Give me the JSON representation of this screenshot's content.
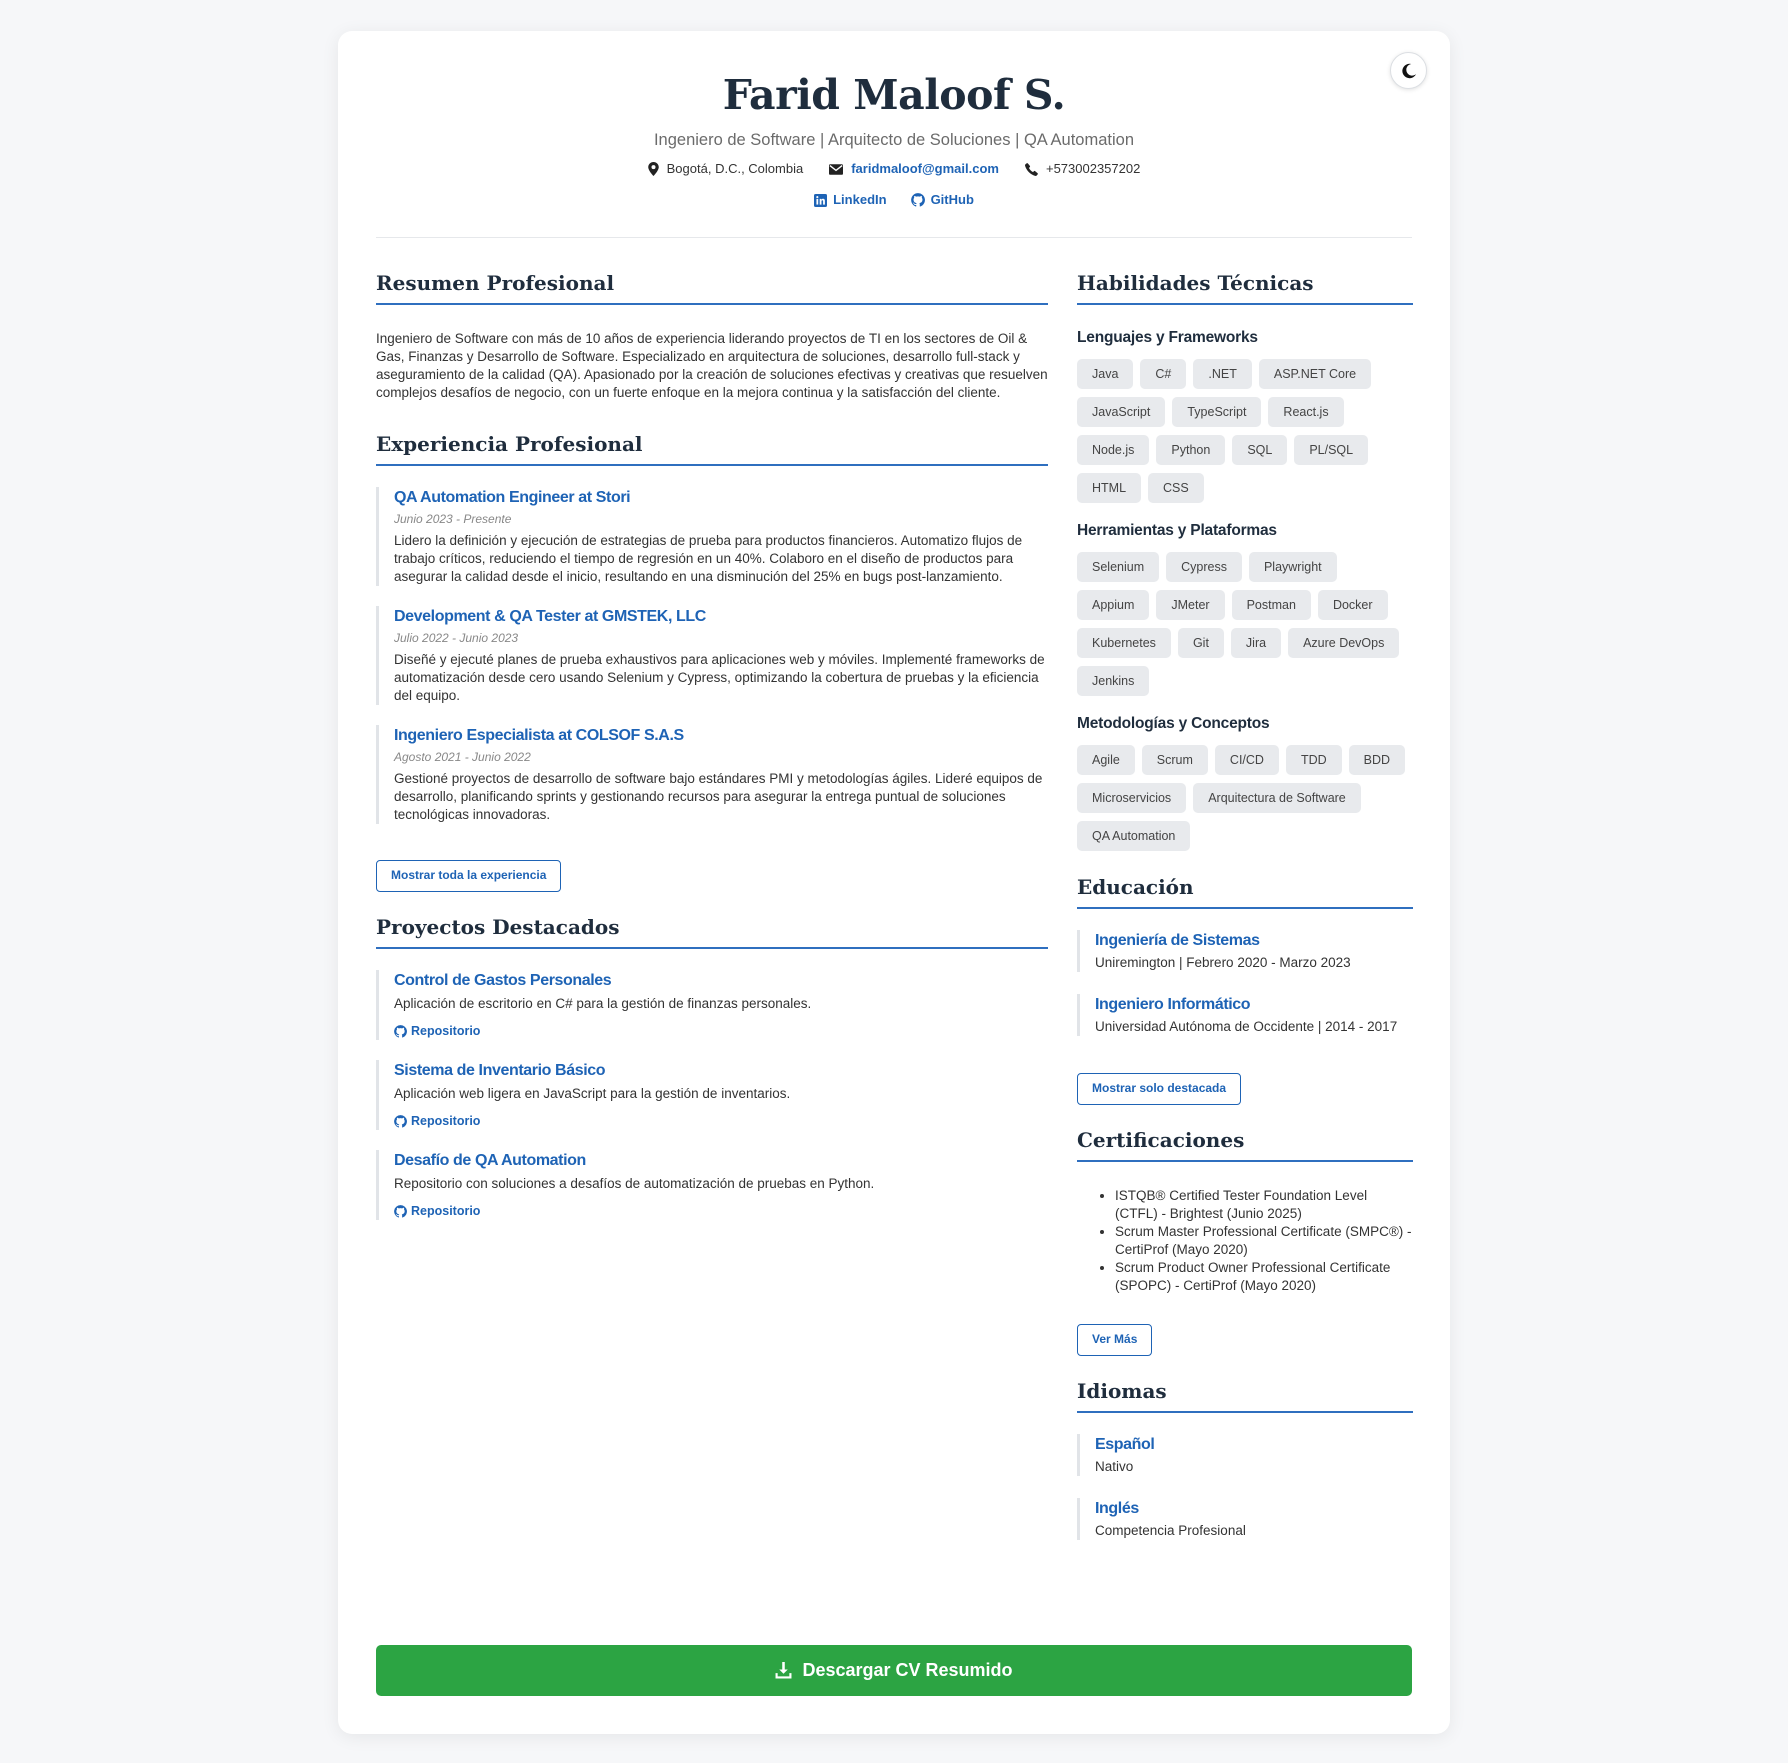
{
  "header": {
    "name": "Farid Maloof S.",
    "title": "Ingeniero de Software | Arquitecto de Soluciones | QA Automation",
    "location": "Bogotá, D.C., Colombia",
    "email": "faridmaloof@gmail.com",
    "phone": "+573002357202",
    "linkedin_label": "LinkedIn",
    "github_label": "GitHub"
  },
  "summary": {
    "title": "Resumen Profesional",
    "text": "Ingeniero de Software con más de 10 años de experiencia liderando proyectos de TI en los sectores de Oil & Gas, Finanzas y Desarrollo de Software. Especializado en arquitectura de soluciones, desarrollo full-stack y aseguramiento de la calidad (QA). Apasionado por la creación de soluciones efectivas y creativas que resuelven complejos desafíos de negocio, con un fuerte enfoque en la mejora continua y la satisfacción del cliente."
  },
  "experience": {
    "title": "Experiencia Profesional",
    "items": [
      {
        "role": "QA Automation Engineer at Stori",
        "date": "Junio 2023 - Presente",
        "description": "Lidero la definición y ejecución de estrategias de prueba para productos financieros. Automatizo flujos de trabajo críticos, reduciendo el tiempo de regresión en un 40%. Colaboro en el diseño de productos para asegurar la calidad desde el inicio, resultando en una disminución del 25% en bugs post-lanzamiento."
      },
      {
        "role": "Development & QA Tester at GMSTEK, LLC",
        "date": "Julio 2022 - Junio 2023",
        "description": "Diseñé y ejecuté planes de prueba exhaustivos para aplicaciones web y móviles. Implementé frameworks de automatización desde cero usando Selenium y Cypress, optimizando la cobertura de pruebas y la eficiencia del equipo."
      },
      {
        "role": "Ingeniero Especialista at COLSOF S.A.S",
        "date": "Agosto 2021 - Junio 2022",
        "description": "Gestioné proyectos de desarrollo de software bajo estándares PMI y metodologías ágiles. Lideré equipos de desarrollo, planificando sprints y gestionando recursos para asegurar la entrega puntual de soluciones tecnológicas innovadoras."
      }
    ],
    "button_label": "Mostrar toda la experiencia"
  },
  "projects": {
    "title": "Proyectos Destacados",
    "link_label": "Repositorio",
    "items": [
      {
        "name": "Control de Gastos Personales",
        "description": "Aplicación de escritorio en C# para la gestión de finanzas personales."
      },
      {
        "name": "Sistema de Inventario Básico",
        "description": "Aplicación web ligera en JavaScript para la gestión de inventarios."
      },
      {
        "name": "Desafío de QA Automation",
        "description": "Repositorio con soluciones a desafíos de automatización de pruebas en Python."
      }
    ]
  },
  "skills": {
    "title": "Habilidades Técnicas",
    "groups": [
      {
        "name": "Lenguajes y Frameworks",
        "tags": [
          "Java",
          "C#",
          ".NET",
          "ASP.NET Core",
          "JavaScript",
          "TypeScript",
          "React.js",
          "Node.js",
          "Python",
          "SQL",
          "PL/SQL",
          "HTML",
          "CSS"
        ]
      },
      {
        "name": "Herramientas y Plataformas",
        "tags": [
          "Selenium",
          "Cypress",
          "Playwright",
          "Appium",
          "JMeter",
          "Postman",
          "Docker",
          "Kubernetes",
          "Git",
          "Jira",
          "Azure DevOps",
          "Jenkins"
        ]
      },
      {
        "name": "Metodologías y Conceptos",
        "tags": [
          "Agile",
          "Scrum",
          "CI/CD",
          "TDD",
          "BDD",
          "Microservicios",
          "Arquitectura de Software",
          "QA Automation"
        ]
      }
    ]
  },
  "education": {
    "title": "Educación",
    "items": [
      {
        "name": "Ingeniería de Sistemas",
        "detail": "Uniremington | Febrero 2020 - Marzo 2023"
      },
      {
        "name": "Ingeniero Informático",
        "detail": "Universidad Autónoma de Occidente | 2014 - 2017"
      }
    ],
    "button_label": "Mostrar solo destacada"
  },
  "certifications": {
    "title": "Certificaciones",
    "items": [
      "ISTQB® Certified Tester Foundation Level (CTFL) - Brightest (Junio 2025)",
      "Scrum Master Professional Certificate (SMPC®) - CertiProf (Mayo 2020)",
      "Scrum Product Owner Professional Certificate (SPOPC) - CertiProf (Mayo 2020)"
    ],
    "button_label": "Ver Más"
  },
  "languages": {
    "title": "Idiomas",
    "items": [
      {
        "name": "Español",
        "level": "Nativo"
      },
      {
        "name": "Inglés",
        "level": "Competencia Profesional"
      }
    ]
  },
  "download_label": "Descargar CV Resumido",
  "colors": {
    "accent": "#1e63b5",
    "download": "#2ca443",
    "heading": "#1f2d3d"
  },
  "icons": {
    "theme_toggle": "moon-icon",
    "location": "map-pin-icon",
    "email": "envelope-icon",
    "phone": "phone-icon",
    "linkedin": "linkedin-icon",
    "github": "github-icon",
    "download": "download-icon"
  }
}
